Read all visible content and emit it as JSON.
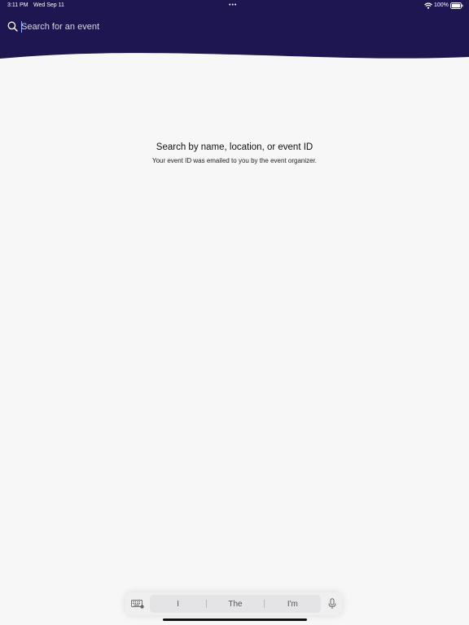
{
  "status_bar": {
    "time": "3:11 PM",
    "date": "Wed Sep 11",
    "battery": "100%",
    "icons": [
      "more-dots-icon",
      "wifi-icon",
      "battery-icon"
    ]
  },
  "search": {
    "placeholder": "Search for an event",
    "value": "",
    "icon": "search-icon"
  },
  "empty_state": {
    "title": "Search by name, location, or event ID",
    "subtitle": "Your event ID was emailed to you by the event organizer."
  },
  "keyboard_bar": {
    "suggestions": [
      "I",
      "The",
      "I'm"
    ],
    "icons": [
      "keyboard-icon",
      "microphone-icon"
    ]
  },
  "colors": {
    "header_bg": "#1d1650",
    "page_bg": "#f7f7f8",
    "caret": "#8fb0ff"
  }
}
